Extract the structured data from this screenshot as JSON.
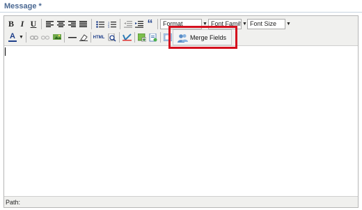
{
  "field_label": "Message *",
  "toolbar": {
    "bold": "B",
    "italic": "I",
    "underline": "U",
    "blockquote": "“",
    "font_color_letter": "A",
    "html_label": "HTML",
    "format_placeholder": "Format",
    "font_family_placeholder": "Font Family",
    "font_size_placeholder": "Font Size"
  },
  "popup": {
    "merge_fields_label": "Merge Fields"
  },
  "statusbar": {
    "path_label": "Path:"
  },
  "colors": {
    "label": "#4a6892",
    "highlight_border": "#d4101e",
    "toolbar_bg": "#f0f0ee"
  }
}
